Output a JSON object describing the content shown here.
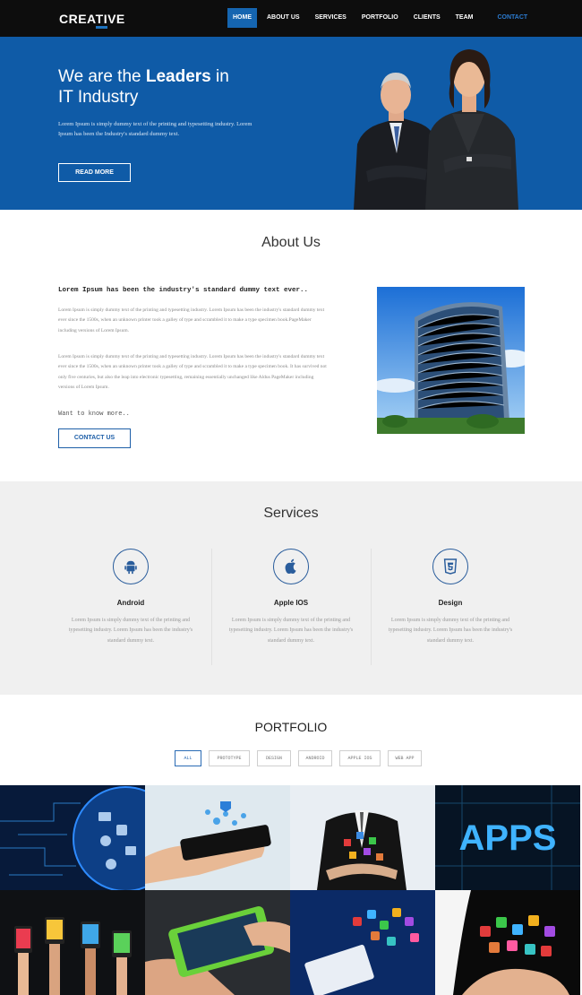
{
  "nav": {
    "logo_prefix": "CREA",
    "logo_highlight": "TI",
    "logo_suffix": "VE",
    "logo_tagline": "",
    "items": [
      "HOME",
      "ABOUT US",
      "SERVICES",
      "PORTFOLIO",
      "CLIENTS",
      "TEAM",
      "CONTACT"
    ],
    "active": "HOME"
  },
  "hero": {
    "heading_pre": "We are the ",
    "heading_bold": "Leaders",
    "heading_post": " in",
    "heading_line2": "IT Industry",
    "text": "Lorem Ipsum is simply dummy text of the printing and typesetting industry. Lorem Ipsum has been the Industry's standard dummy text.",
    "button": "READ MORE"
  },
  "about": {
    "title": "About Us",
    "lead": "Lorem Ipsum has been the industry's standard dummy text ever..",
    "paragraph1": "Lorem Ipsum is simply dummy text of the printing and typesetting industry. Lorem Ipsum has been the industry's standard dummy text ever since the 1500s, when an unknown printer took a galley of type and scrambled it to make a type specimen book.PageMaker including versions of Lorem Ipsum.",
    "paragraph2": "Lorem Ipsum is simply dummy text of the printing and typesetting industry. Lorem Ipsum has been the industry's standard dummy text ever since the 1500s, when an unknown printer took a galley of type and scrambled it to make a type specimen book. It has survived not only five centuries, but also the leap into electronic typesetting, remaining essentially unchanged like Aldus PageMaker including versions of Lorem Ipsum.",
    "want": "Want to know more..",
    "button": "CONTACT US"
  },
  "services": {
    "title": "Services",
    "items": [
      {
        "name": "Android",
        "icon": "android-icon",
        "text": "Lorem Ipsum is simply dummy text of the printing and typesetting industry. Lorem Ipsum has been the industry's standard dummy text."
      },
      {
        "name": "Apple IOS",
        "icon": "apple-icon",
        "text": "Lorem Ipsum is simply dummy text of the printing and typesetting industry. Lorem Ipsum has been the industry's standard dummy text."
      },
      {
        "name": "Design",
        "icon": "html5-icon",
        "text": "Lorem Ipsum is simply dummy text of the printing and typesetting industry. Lorem Ipsum has been the industry's standard dummy text."
      }
    ]
  },
  "portfolio": {
    "title": "PORTFOLIO",
    "filters": [
      "ALL",
      "PROTOTYPE",
      "DESIGN",
      "ANDROID",
      "APPLE IOS",
      "WEB APP"
    ],
    "active_filter": "ALL",
    "tiles": [
      "apps-circuit-image",
      "phone-hand-image",
      "businessman-apps-image",
      "apps-text-image",
      "hands-phones-image",
      "green-phone-image",
      "tablet-apps-image",
      "hand-apps-image"
    ],
    "tile_text": "APPS"
  },
  "colors": {
    "accent": "#1565b0",
    "hero_bg": "#0f5ba7",
    "nav_bg": "#0d0d0d",
    "services_bg": "#f0f0f0"
  }
}
